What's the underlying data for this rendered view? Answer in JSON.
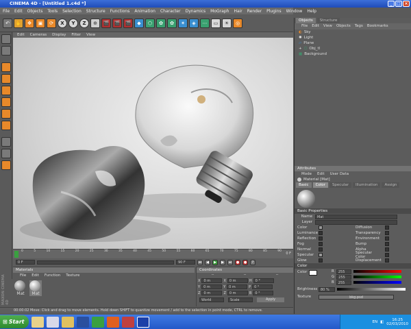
{
  "window": {
    "title": "CINEMA 4D - [Untitled 1.c4d *]"
  },
  "menu": [
    "File",
    "Edit",
    "Objects",
    "Tools",
    "Selection",
    "Structure",
    "Functions",
    "Animation",
    "Character",
    "Dynamics",
    "MoGraph",
    "Hair",
    "Render",
    "Plugins",
    "Window",
    "Help"
  ],
  "viewport_menu": [
    "Edit",
    "Cameras",
    "Display",
    "Filter",
    "View"
  ],
  "toolbar": {
    "axes": [
      "X",
      "Y",
      "Z"
    ]
  },
  "timeline": {
    "ticks": [
      "0",
      "5",
      "10",
      "15",
      "20",
      "25",
      "30",
      "35",
      "40",
      "45",
      "50",
      "55",
      "60",
      "65",
      "70",
      "75",
      "80",
      "85",
      "90"
    ],
    "end_label": "0 F"
  },
  "transport": {
    "start": "0 F",
    "end": "90 F"
  },
  "materials": {
    "title": "Materials",
    "menu": [
      "File",
      "Edit",
      "Function",
      "Texture"
    ],
    "items": [
      {
        "label": "Mat"
      },
      {
        "label": "Mat"
      }
    ]
  },
  "coordinates": {
    "title": "Coordinates",
    "headers": [
      "--",
      "--",
      "--"
    ],
    "rows": [
      {
        "a": "X",
        "av": "0 m",
        "b": "X",
        "bv": "0 m",
        "c": "H",
        "cv": "0 °"
      },
      {
        "a": "Y",
        "av": "0 m",
        "b": "Y",
        "bv": "0 m",
        "c": "P",
        "cv": "0 °"
      },
      {
        "a": "Z",
        "av": "0 m",
        "b": "Z",
        "bv": "0 m",
        "c": "B",
        "cv": "0 °"
      }
    ],
    "world": "World",
    "scale": "Scale",
    "apply": "Apply"
  },
  "objects": {
    "tabs": [
      "Objects",
      "Structure"
    ],
    "menu": [
      "File",
      "Edit",
      "View",
      "Objects",
      "Tags",
      "Bookmarks"
    ],
    "rows": [
      {
        "name": "Sky"
      },
      {
        "name": "Light"
      },
      {
        "name": "Plane"
      },
      {
        "name": "Obj_tl"
      },
      {
        "name": "Background"
      }
    ]
  },
  "attributes": {
    "title": "Attributes",
    "menu": [
      "Mode",
      "Edit",
      "User Data"
    ],
    "material_label": "Material [Mat]",
    "tabs": [
      "Basic",
      "Color",
      "Specular",
      "Illumination",
      "Assign"
    ],
    "section": "Basic Properties",
    "name_label": "Name",
    "name_value": "Mat",
    "layer_label": "Layer",
    "channels_left": [
      "Color",
      "Luminance",
      "Reflection",
      "Fog",
      "Normal",
      "Specular",
      "Glow"
    ],
    "channels_right": [
      "Diffusion",
      "Transparency",
      "Environment",
      "Bump",
      "Alpha",
      "Specular Color",
      "Displacement"
    ],
    "color_section": "Color",
    "color_label": "Color",
    "rgb": [
      {
        "k": "R",
        "v": "255"
      },
      {
        "k": "G",
        "v": "255"
      },
      {
        "k": "B",
        "v": "255"
      }
    ],
    "brightness_label": "Brightness",
    "brightness_value": "80 %",
    "texture_label": "Texture",
    "texture_value": "bkg.psd"
  },
  "status": {
    "text": "00:00:02  Move: Click and drag to move elements. Hold down SHIFT to quantize movement / add to the selection in point mode, CTRL to remove."
  },
  "taskbar": {
    "start_label": "Start",
    "lang": "EN",
    "time": "16:25",
    "date": "02/03/2010"
  },
  "branding": {
    "side_logo": "MAXON CINEMA 4D"
  },
  "colors": {
    "accent": "#3c6fd8",
    "panel": "#5c5c5c",
    "orange": "#e8892a"
  }
}
